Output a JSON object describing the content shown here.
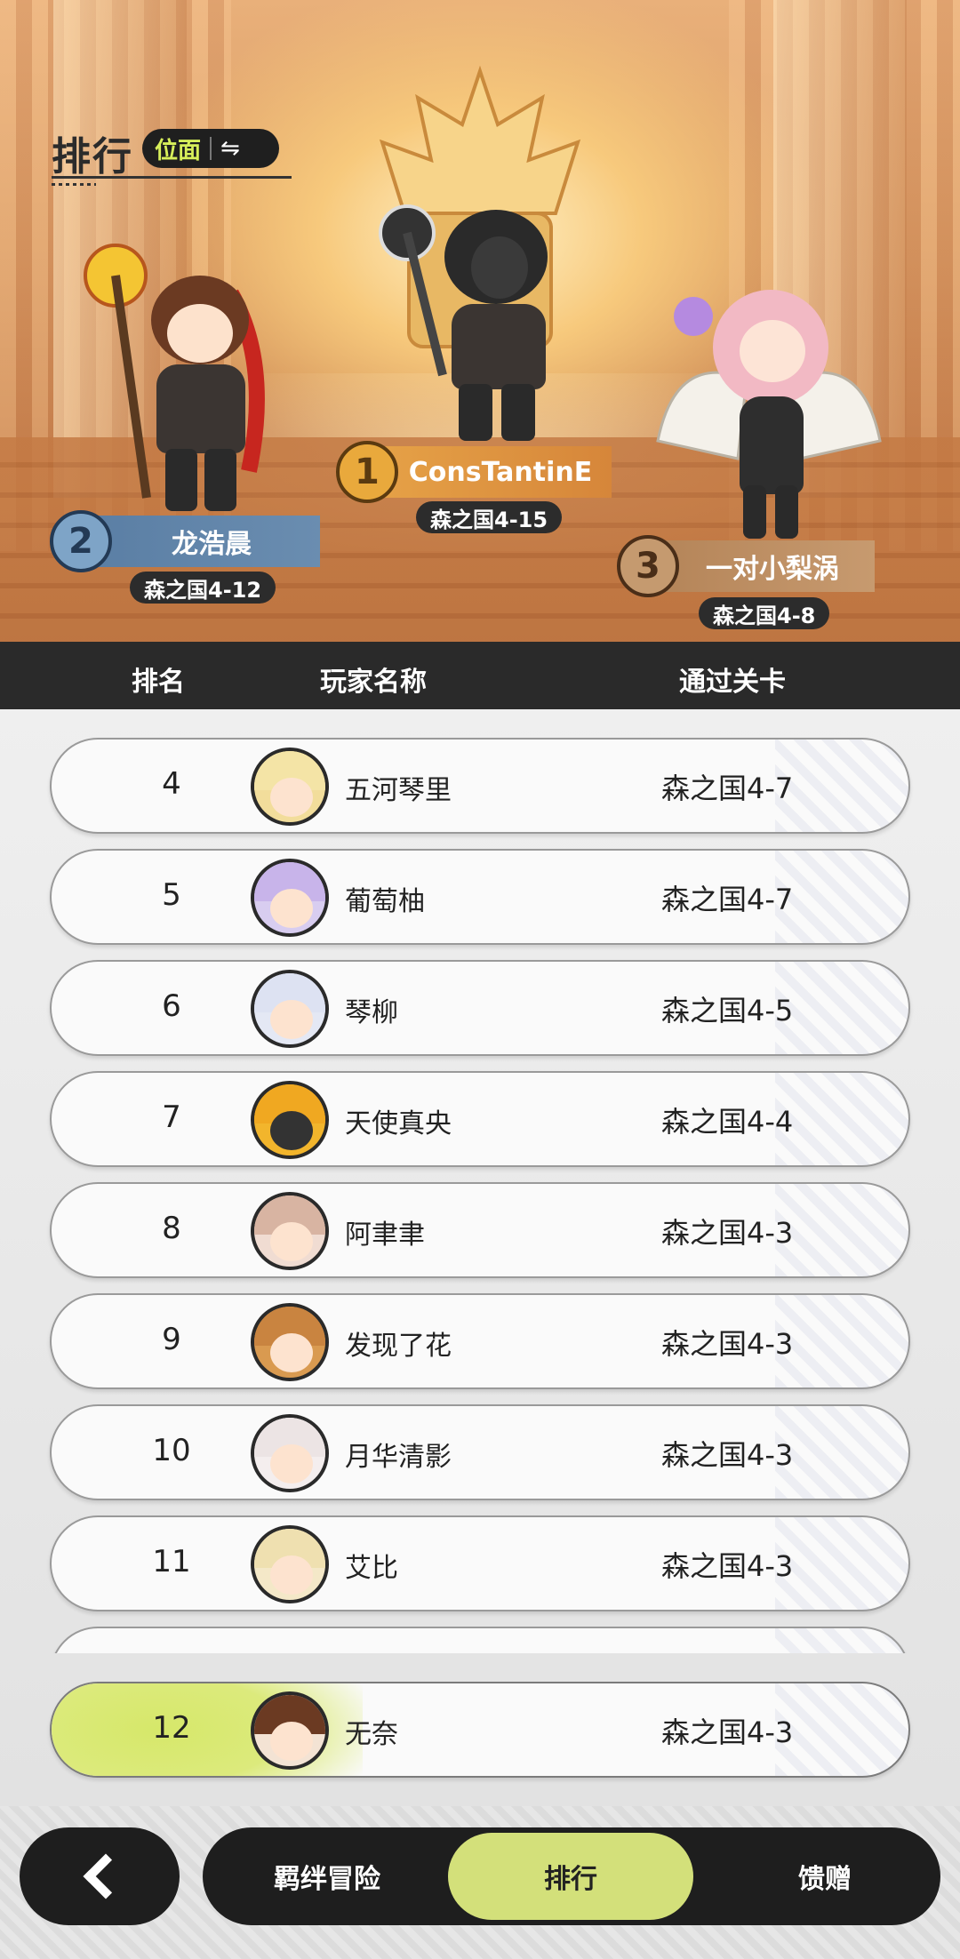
{
  "header": {
    "title": "排行",
    "mode_label": "位面",
    "swap_icon": "⇋"
  },
  "podium": {
    "first": {
      "rank": "1",
      "name": "ConsTantinE",
      "stage": "森之国4-15"
    },
    "second": {
      "rank": "2",
      "name": "龙浩晨",
      "stage": "森之国4-12"
    },
    "third": {
      "rank": "3",
      "name": "一对小梨涡",
      "stage": "森之国4-8"
    }
  },
  "columns": {
    "rank": "排名",
    "player": "玩家名称",
    "stage": "通过关卡"
  },
  "rows": [
    {
      "rank": "4",
      "name": "五河琴里",
      "stage": "森之国4-7"
    },
    {
      "rank": "5",
      "name": "葡萄柚",
      "stage": "森之国4-7"
    },
    {
      "rank": "6",
      "name": "琴柳",
      "stage": "森之国4-5"
    },
    {
      "rank": "7",
      "name": "天使真央",
      "stage": "森之国4-4"
    },
    {
      "rank": "8",
      "name": "阿聿聿",
      "stage": "森之国4-3"
    },
    {
      "rank": "9",
      "name": "发现了花",
      "stage": "森之国4-3"
    },
    {
      "rank": "10",
      "name": "月华清影",
      "stage": "森之国4-3"
    },
    {
      "rank": "11",
      "name": "艾比",
      "stage": "森之国4-3"
    }
  ],
  "self_row": {
    "rank": "12",
    "name": "无奈",
    "stage": "森之国4-3"
  },
  "nav": {
    "tabs": [
      {
        "label": "羁绊冒险"
      },
      {
        "label": "排行"
      },
      {
        "label": "馈赠"
      }
    ],
    "active_tab": "排行"
  },
  "colors": {
    "accent": "#d3e07a",
    "mode_text": "#d7ef5a",
    "dark": "#1e1e1e"
  }
}
